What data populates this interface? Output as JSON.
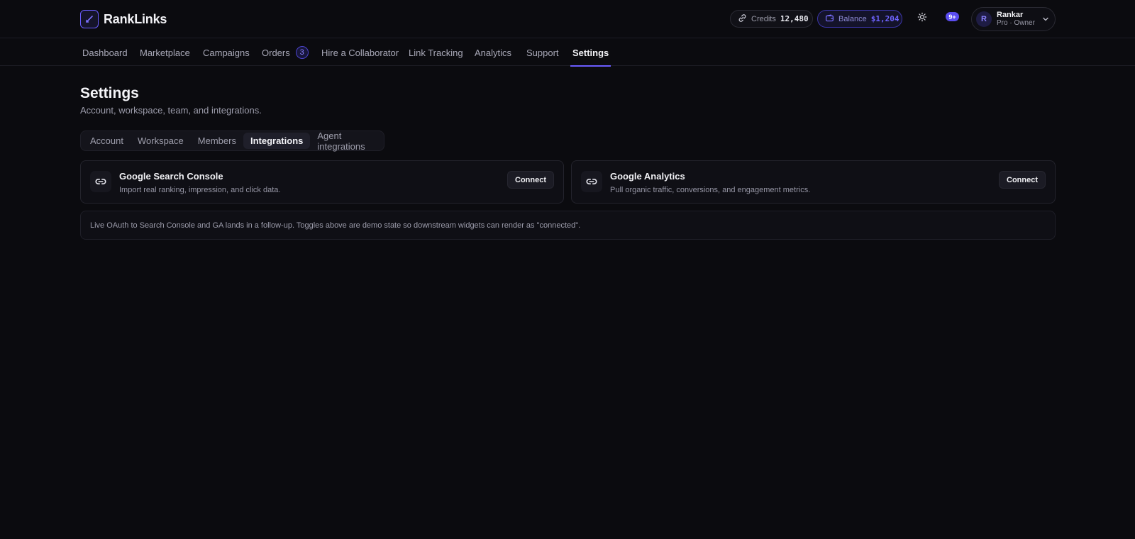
{
  "app": {
    "name": "RankLinks"
  },
  "header": {
    "credits": {
      "label": "Credits",
      "value": "12,480"
    },
    "balance": {
      "label": "Balance",
      "value": "$1,204"
    },
    "notifications": {
      "badge": "9+"
    },
    "user": {
      "initial": "R",
      "name": "Rankar",
      "role": "Pro · Owner"
    }
  },
  "nav": {
    "items": [
      {
        "label": "Dashboard"
      },
      {
        "label": "Marketplace"
      },
      {
        "label": "Campaigns"
      },
      {
        "label": "Orders",
        "badge": "3"
      },
      {
        "label": "Hire a Collaborator"
      },
      {
        "label": "Link Tracking"
      },
      {
        "label": "Analytics"
      },
      {
        "label": "Support"
      },
      {
        "label": "Settings",
        "active": true
      }
    ]
  },
  "page": {
    "title": "Settings",
    "subtitle": "Account, workspace, team, and integrations."
  },
  "tabs": [
    {
      "label": "Account"
    },
    {
      "label": "Workspace"
    },
    {
      "label": "Members"
    },
    {
      "label": "Integrations",
      "active": true
    },
    {
      "label": "Agent integrations"
    }
  ],
  "integrations": [
    {
      "name": "Google Search Console",
      "description": "Import real ranking, impression, and click data.",
      "button": "Connect",
      "icon": "link-icon"
    },
    {
      "name": "Google Analytics",
      "description": "Pull organic traffic, conversions, and engagement metrics.",
      "button": "Connect",
      "icon": "link-icon"
    }
  ],
  "note": "Live OAuth to Search Console and GA lands in a follow-up. Toggles above are demo state so downstream widgets can render as \"connected\".",
  "colors": {
    "accent": "#6a5cff",
    "background": "#0b0b0f"
  }
}
